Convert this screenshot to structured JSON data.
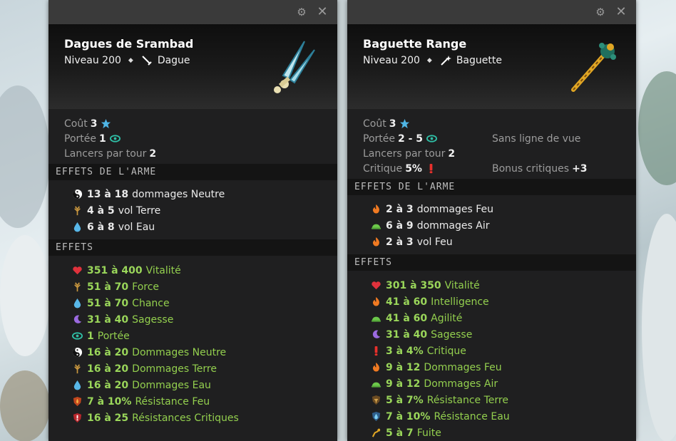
{
  "left": {
    "name": "Dagues de Srambad",
    "level": "Niveau 200",
    "type": "Dague",
    "stats": {
      "cost_label": "Coût",
      "cost_value": "3",
      "range_label": "Portée",
      "range_value": "1",
      "casts_label": "Lancers par tour",
      "casts_value": "2"
    },
    "weapon_effects_title": "EFFETS DE L'ARME",
    "weapon_effects": [
      {
        "icon": "neutral-icon",
        "value": "13 à 18",
        "text": "dommages Neutre"
      },
      {
        "icon": "earth-icon",
        "value": "4 à 5",
        "text": "vol Terre"
      },
      {
        "icon": "water-icon",
        "value": "6 à 8",
        "text": "vol Eau"
      }
    ],
    "effects_title": "EFFETS",
    "effects": [
      {
        "icon": "heart-icon",
        "value": "351 à 400",
        "text": "Vitalité"
      },
      {
        "icon": "earth-icon",
        "value": "51 à 70",
        "text": "Force"
      },
      {
        "icon": "water-icon",
        "value": "51 à 70",
        "text": "Chance"
      },
      {
        "icon": "wisdom-icon",
        "value": "31 à 40",
        "text": "Sagesse"
      },
      {
        "icon": "eye-icon",
        "value": "1",
        "text": "Portée"
      },
      {
        "icon": "neutral-icon",
        "value": "16 à 20",
        "text": "Dommages Neutre"
      },
      {
        "icon": "earth-icon",
        "value": "16 à 20",
        "text": "Dommages Terre"
      },
      {
        "icon": "water-icon",
        "value": "16 à 20",
        "text": "Dommages Eau"
      },
      {
        "icon": "fire-shield-icon",
        "value": "7 à 10%",
        "text": "Résistance Feu"
      },
      {
        "icon": "crit-shield-icon",
        "value": "16 à 25",
        "text": "Résistances Critiques"
      }
    ]
  },
  "right": {
    "name": "Baguette Range",
    "level": "Niveau 200",
    "type": "Baguette",
    "stats": {
      "cost_label": "Coût",
      "cost_value": "3",
      "range_label": "Portée",
      "range_value": "2 - 5",
      "los_label": "Sans ligne de vue",
      "casts_label": "Lancers par tour",
      "casts_value": "2",
      "crit_label": "Critique",
      "crit_value": "5%",
      "crit_bonus_label": "Bonus critiques",
      "crit_bonus_value": "+3"
    },
    "weapon_effects_title": "EFFETS DE L'ARME",
    "weapon_effects": [
      {
        "icon": "fire-icon",
        "value": "2 à 3",
        "text": "dommages Feu"
      },
      {
        "icon": "air-icon",
        "value": "6 à 9",
        "text": "dommages Air"
      },
      {
        "icon": "fire-icon",
        "value": "2 à 3",
        "text": "vol Feu"
      }
    ],
    "effects_title": "EFFETS",
    "effects": [
      {
        "icon": "heart-icon",
        "value": "301 à 350",
        "text": "Vitalité"
      },
      {
        "icon": "fire-icon",
        "value": "41 à 60",
        "text": "Intelligence"
      },
      {
        "icon": "air-icon",
        "value": "41 à 60",
        "text": "Agilité"
      },
      {
        "icon": "wisdom-icon",
        "value": "31 à 40",
        "text": "Sagesse"
      },
      {
        "icon": "crit-icon",
        "value": "3 à 4%",
        "text": "Critique"
      },
      {
        "icon": "fire-icon",
        "value": "9 à 12",
        "text": "Dommages Feu"
      },
      {
        "icon": "air-icon",
        "value": "9 à 12",
        "text": "Dommages Air"
      },
      {
        "icon": "earth-shield-icon",
        "value": "5 à 7%",
        "text": "Résistance Terre"
      },
      {
        "icon": "water-shield-icon",
        "value": "7 à 10%",
        "text": "Résistance Eau"
      },
      {
        "icon": "flee-icon",
        "value": "5 à 7",
        "text": "Fuite"
      }
    ]
  },
  "colors": {
    "panel_bg": "#1f1f20",
    "effect_green": "#93cf4e",
    "section_bg": "#141414"
  }
}
